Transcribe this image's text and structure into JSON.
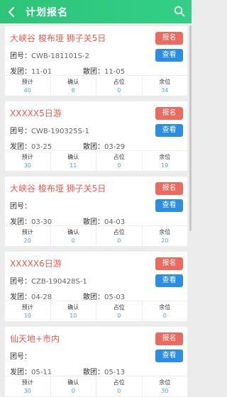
{
  "header": {
    "title": "计划报名"
  },
  "labels": {
    "team_no": "团号：",
    "depart": "发团：",
    "end": "散团：",
    "stat_plan": "预计",
    "stat_confirm": "确认",
    "stat_hold": "占位",
    "stat_remain": "余位",
    "sign_btn": "报名",
    "view_btn": "查看"
  },
  "colors": {
    "header": "#2ec47a",
    "title_red": "#ef5a4c",
    "sign_btn": "#ef6a5e",
    "view_btn": "#2a8ee6",
    "stat_value": "#4fa5e8"
  },
  "cards": [
    {
      "name": "大峡谷 梭布垭 狮子关5日",
      "team_no": "CWB-181101S-2",
      "depart": "11-01",
      "end": "11-05",
      "plan": "40",
      "confirm": "6",
      "hold": "0",
      "remain": "34"
    },
    {
      "name": "XXXXX5日游",
      "team_no": "CWB-190325S-1",
      "depart": "03-25",
      "end": "03-29",
      "plan": "30",
      "confirm": "11",
      "hold": "0",
      "remain": "19"
    },
    {
      "name": "大峡谷 梭布垭 狮子关5日",
      "team_no": "",
      "depart": "03-30",
      "end": "04-03",
      "plan": "20",
      "confirm": "0",
      "hold": "0",
      "remain": "20"
    },
    {
      "name": "XXXXX6日游",
      "team_no": "CZB-190428S-1",
      "depart": "04-28",
      "end": "05-03",
      "plan": "10",
      "confirm": "10",
      "hold": "0",
      "remain": "0"
    },
    {
      "name": "仙天地+市内",
      "team_no": "",
      "depart": "05-11",
      "end": "05-13",
      "plan": "30",
      "confirm": "0",
      "hold": "0",
      "remain": "30"
    }
  ]
}
